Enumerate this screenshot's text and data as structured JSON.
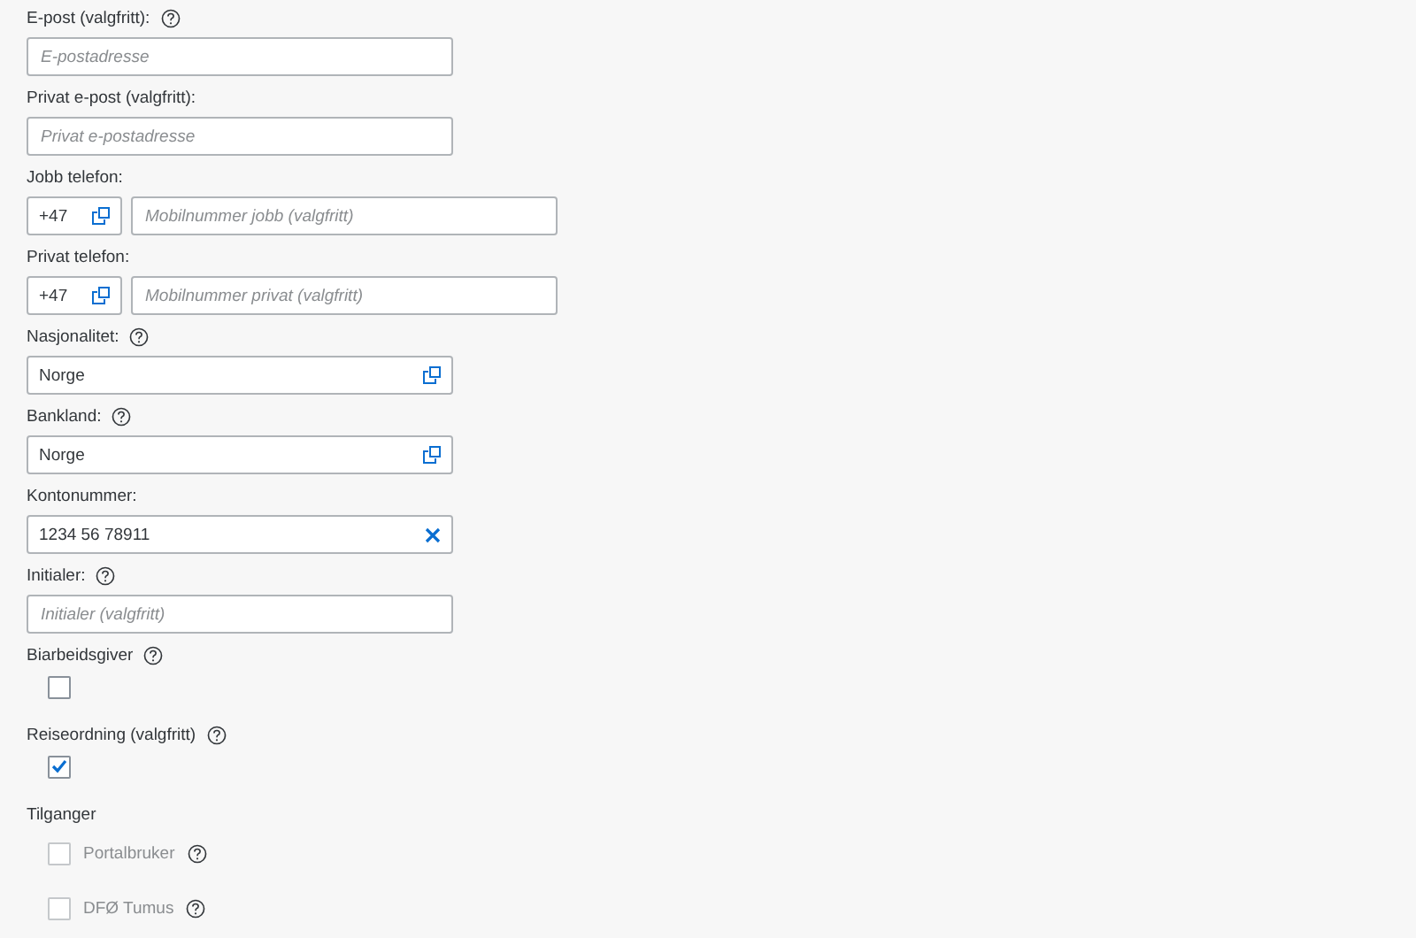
{
  "fields": [
    {
      "kind": "text",
      "label": "E-post (valgfritt):",
      "help": true,
      "placeholder": "E-postadresse"
    },
    {
      "kind": "text",
      "label": "Privat e-post (valgfritt):",
      "help": false,
      "placeholder": "Privat e-postadresse"
    },
    {
      "kind": "phone",
      "label": "Jobb telefon:",
      "help": false,
      "prefix": "+47",
      "placeholder": "Mobilnummer jobb (valgfritt)"
    },
    {
      "kind": "phone",
      "label": "Privat telefon:",
      "help": false,
      "prefix": "+47",
      "placeholder": "Mobilnummer privat (valgfritt)"
    },
    {
      "kind": "select",
      "label": "Nasjonalitet:",
      "help": true,
      "value": "Norge"
    },
    {
      "kind": "select",
      "label": "Bankland:",
      "help": true,
      "value": "Norge"
    },
    {
      "kind": "clearable",
      "label": "Kontonummer:",
      "help": false,
      "value": "1234 56 78911"
    },
    {
      "kind": "text",
      "label": "Initialer:",
      "help": true,
      "placeholder": "Initialer (valgfritt)"
    },
    {
      "kind": "checkbox",
      "label": "Biarbeidsgiver",
      "help": true,
      "checked": false
    },
    {
      "kind": "checkbox",
      "label": "Reiseordning (valgfritt)",
      "help": true,
      "checked": true
    }
  ],
  "access": {
    "title": "Tilganger",
    "items": [
      {
        "label": "Portalbruker",
        "help": true,
        "checked": false,
        "disabled": true
      },
      {
        "label": "DFØ Tumus",
        "help": true,
        "checked": false,
        "disabled": true
      }
    ]
  }
}
